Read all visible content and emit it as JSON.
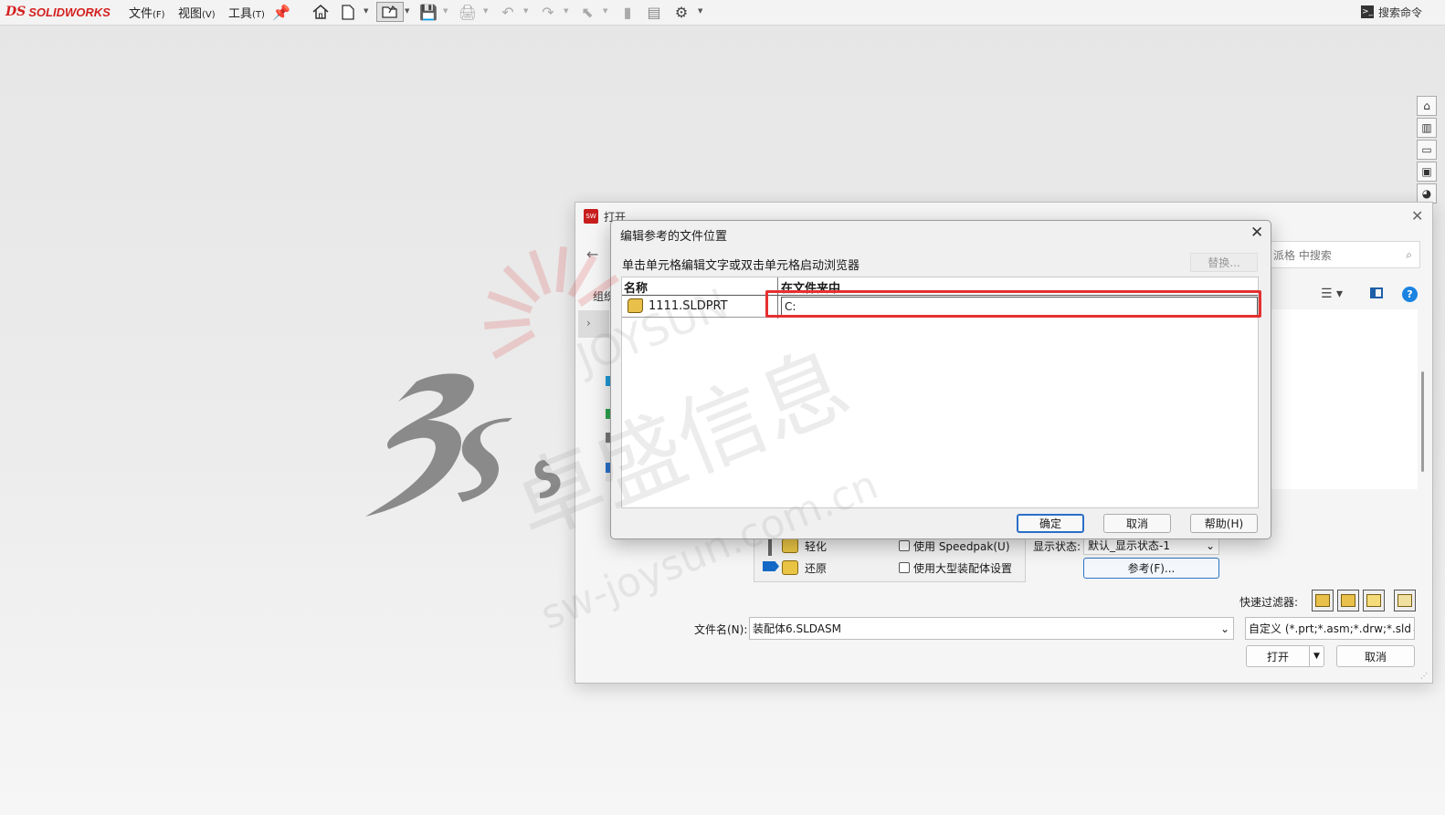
{
  "app": {
    "logo_prefix": "DS",
    "logo_text": "SOLIDWORKS",
    "menu": [
      {
        "label": "文件",
        "key": "(F)"
      },
      {
        "label": "视图",
        "key": "(V)"
      },
      {
        "label": "工具",
        "key": "(T)"
      }
    ],
    "search_commands": "搜索命令"
  },
  "open_dialog": {
    "title": "打开",
    "search_placeholder": "派格 中搜索",
    "organize_label": "组织",
    "modes": {
      "lightweight": "轻化",
      "resolve": "还原",
      "speedpak": "使用 Speedpak(U)",
      "large_assembly": "使用大型装配体设置"
    },
    "display_state_label": "显示状态:",
    "display_state_value": "默认_显示状态-1",
    "references_button": "参考(F)...",
    "quick_filter_label": "快速过滤器:",
    "file_name_label": "文件名(N):",
    "file_name_value": "装配体6.SLDASM",
    "file_type_value": "自定义 (*.prt;*.asm;*.drw;*.sld",
    "open_button": "打开",
    "cancel_button": "取消"
  },
  "ref_dialog": {
    "title": "编辑参考的文件位置",
    "instruction": "单击单元格编辑文字或双击单元格启动浏览器",
    "replace_button": "替换...",
    "columns": [
      "名称",
      "在文件夹中"
    ],
    "rows": [
      {
        "name": "1111.SLDPRT",
        "folder": "C:"
      }
    ],
    "ok_button": "确定",
    "cancel_button": "取消",
    "help_button": "帮助(H)"
  },
  "watermark": {
    "line1": "卓盛信息",
    "line2": "sw-joysun.com.cn",
    "line3": "JOYSUN"
  },
  "colors": {
    "accent_red": "#e53030",
    "brand_red": "#d51f1f",
    "focus_blue": "#2c6ec7"
  }
}
